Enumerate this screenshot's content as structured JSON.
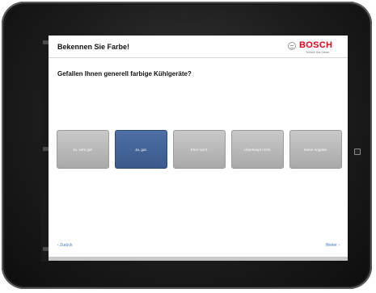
{
  "header": {
    "title": "Bekennen Sie Farbe!",
    "brand": "BOSCH",
    "brand_tagline": "Technik fürs Leben"
  },
  "question": "Gefallen Ihnen generell farbige Kühlgeräte?",
  "options": [
    {
      "label": "Ja, sehr gut.",
      "selected": false
    },
    {
      "label": "Ja, gut.",
      "selected": true
    },
    {
      "label": "Eher nicht.",
      "selected": false
    },
    {
      "label": "Überhaupt nicht.",
      "selected": false
    },
    {
      "label": "Keine Angabe.",
      "selected": false
    }
  ],
  "nav": {
    "back": "‹ Zurück",
    "next": "Weiter ›"
  },
  "colors": {
    "selected": "#3f5f92",
    "unselected": "#b5b5b5",
    "brand_red": "#e2001a",
    "link_blue": "#3b78c2"
  }
}
